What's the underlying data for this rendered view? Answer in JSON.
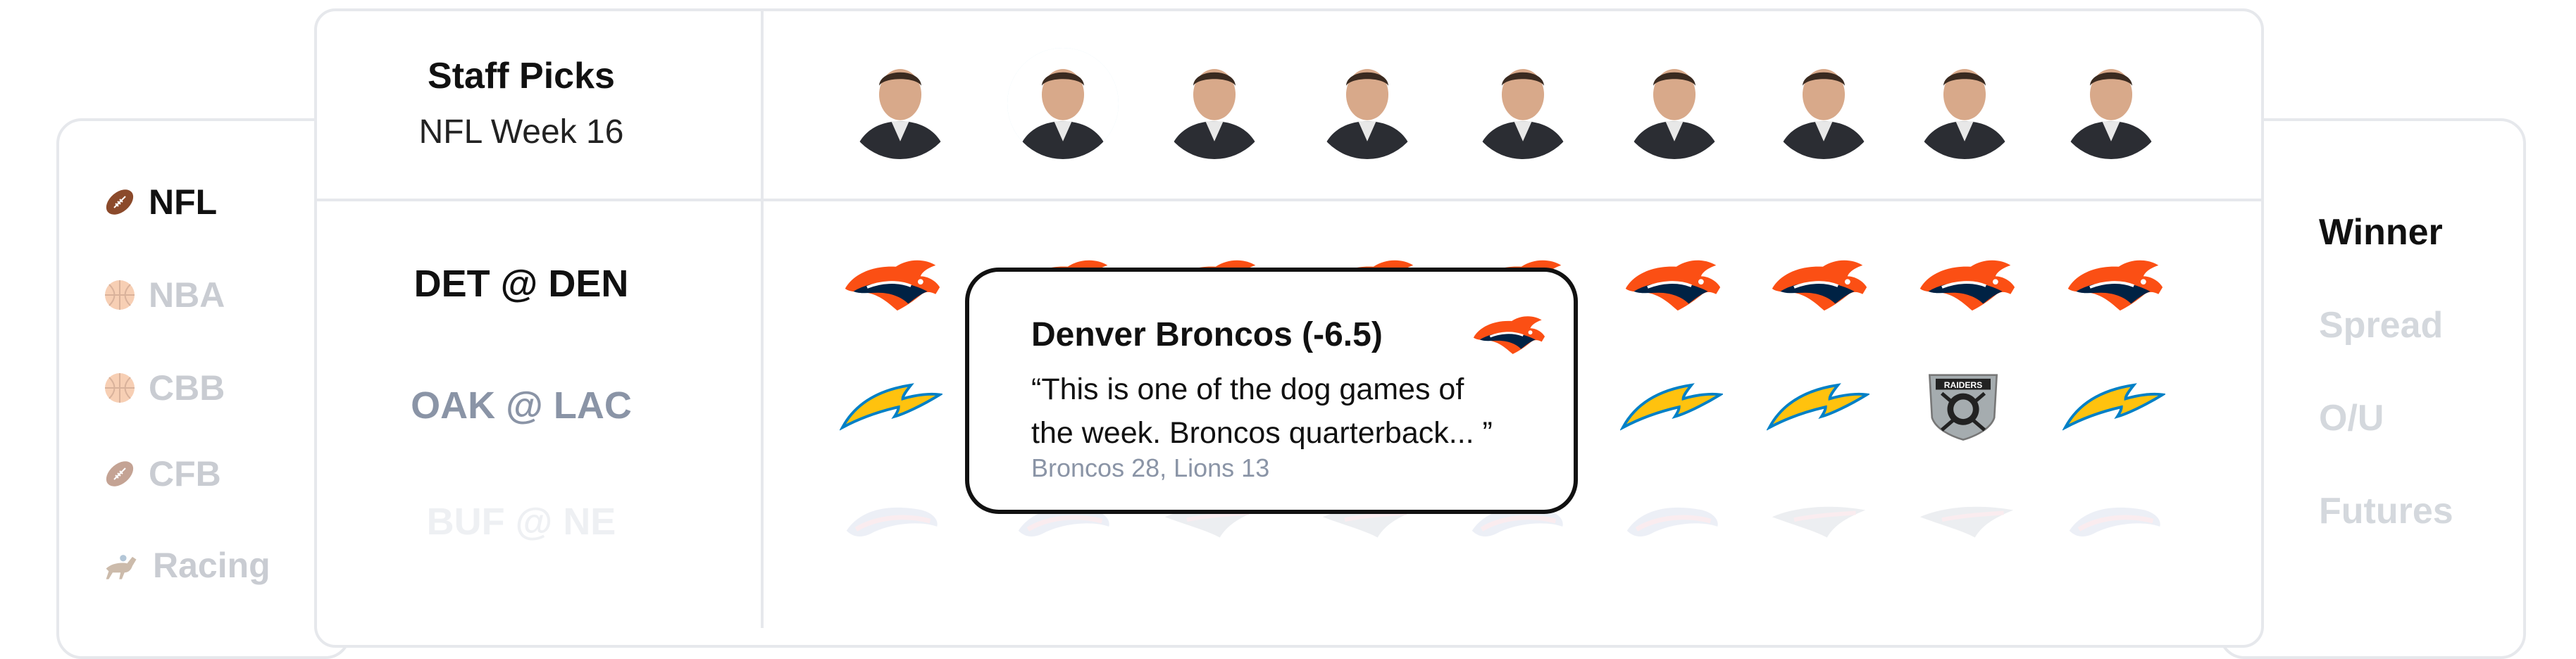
{
  "sports_nav": {
    "items": [
      {
        "label": "NFL",
        "icon": "football-icon",
        "active": true
      },
      {
        "label": "NBA",
        "icon": "basketball-icon",
        "active": false
      },
      {
        "label": "CBB",
        "icon": "basketball-icon",
        "active": false
      },
      {
        "label": "CFB",
        "icon": "football-icon",
        "active": false
      },
      {
        "label": "Racing",
        "icon": "horse-racing-icon",
        "active": false
      }
    ]
  },
  "staff_picks": {
    "title": "Staff Picks",
    "subtitle": "NFL Week 16"
  },
  "games": [
    {
      "label": "DET @ DEN",
      "state": "active",
      "picks": [
        "broncos",
        "broncos",
        "broncos",
        "broncos",
        "broncos",
        "broncos",
        "broncos",
        "broncos",
        "broncos"
      ]
    },
    {
      "label": "OAK @ LAC",
      "state": "secondary",
      "picks": [
        "chargers",
        "chargers",
        "chargers",
        "chargers",
        "chargers",
        "chargers",
        "chargers",
        "raiders",
        "chargers"
      ]
    },
    {
      "label": "BUF @ NE",
      "state": "faded",
      "picks": [
        "bills",
        "bills",
        "patriots",
        "patriots",
        "bills",
        "bills",
        "patriots",
        "patriots",
        "bills"
      ]
    }
  ],
  "experts_count_shown": 9,
  "markets": {
    "items": [
      {
        "label": "Winner",
        "active": true
      },
      {
        "label": "Spread",
        "active": false
      },
      {
        "label": "O/U",
        "active": false
      },
      {
        "label": "Futures",
        "active": false
      }
    ]
  },
  "popup": {
    "title": "Denver Broncos (-6.5)",
    "quote": "“This is one of the dog games of the week. Broncos quarterback... ”",
    "score": "Broncos 28, Lions 13",
    "logo": "broncos-logo-icon"
  },
  "colors": {
    "broncos_orange": "#fb4f14",
    "broncos_navy": "#002244",
    "chargers_yellow": "#ffc20e",
    "chargers_blue": "#0080c6",
    "raiders_silver": "#a5acaf",
    "inactive_text": "#c9ccd2",
    "secondary_text": "#8a94a6",
    "border": "#e6e8ec"
  }
}
